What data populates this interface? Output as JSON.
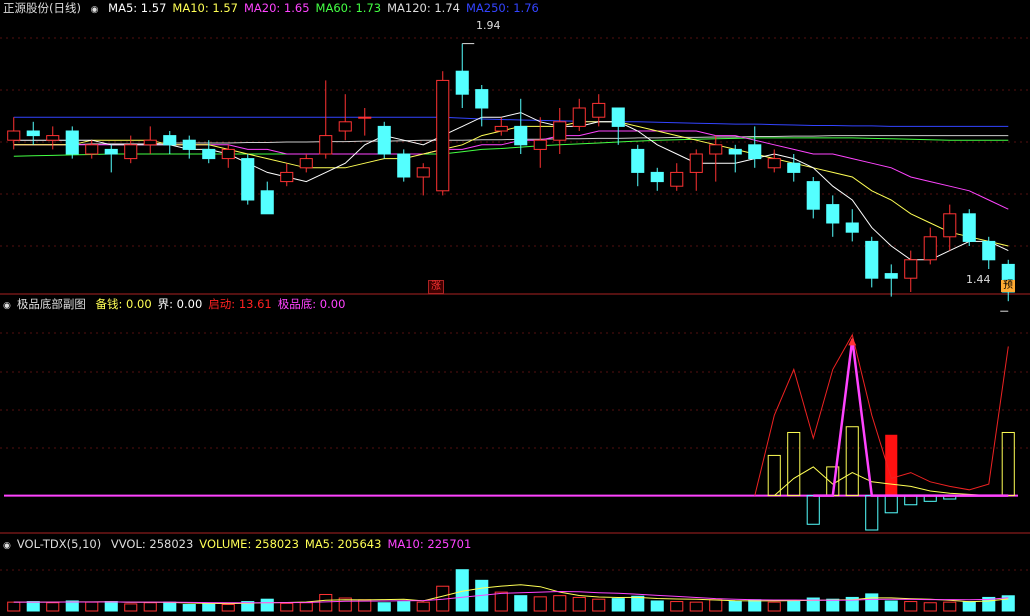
{
  "stock": {
    "name": "正源股份",
    "period": "(日线)"
  },
  "panels": {
    "price": {
      "indicators": [
        {
          "label": "MA5",
          "value": "1.57",
          "color": "#ffffff"
        },
        {
          "label": "MA10",
          "value": "1.57",
          "color": "#ffff55"
        },
        {
          "label": "MA20",
          "value": "1.65",
          "color": "#ff44ff"
        },
        {
          "label": "MA60",
          "value": "1.73",
          "color": "#44ff44"
        },
        {
          "label": "MA120",
          "value": "1.74",
          "color": "#dddddd"
        },
        {
          "label": "MA250",
          "value": "1.76",
          "color": "#3344ff"
        }
      ],
      "high_label": "1.94",
      "low_label": "1.44",
      "marker_zhang": "涨",
      "marker_bottom_right": "预"
    },
    "indicator": {
      "name": "极品底部副图",
      "fields": [
        {
          "label": "备钱",
          "value": "0.00",
          "color": "#ffff55"
        },
        {
          "label": "界",
          "value": "0.00",
          "color": "#ffffff"
        },
        {
          "label": "启动",
          "value": "13.61",
          "color": "#ff2222"
        },
        {
          "label": "极品底",
          "value": "0.00",
          "color": "#ff44ff"
        }
      ]
    },
    "volume": {
      "name": "VOL-TDX(5,10)",
      "fields": [
        {
          "label": "VVOL",
          "value": "258023",
          "color": "#dddddd"
        },
        {
          "label": "VOLUME",
          "value": "258023",
          "color": "#ffff55"
        },
        {
          "label": "MA5",
          "value": "205643",
          "color": "#ffff55"
        },
        {
          "label": "MA10",
          "value": "225701",
          "color": "#ff44ff"
        }
      ]
    }
  },
  "chart_data": [
    {
      "type": "candlestick",
      "ylim": [
        1.4,
        2.0
      ],
      "candles": [
        [
          1.73,
          1.75,
          1.78,
          1.71
        ],
        [
          1.75,
          1.74,
          1.77,
          1.72
        ],
        [
          1.73,
          1.74,
          1.76,
          1.71
        ],
        [
          1.75,
          1.7,
          1.76,
          1.69
        ],
        [
          1.7,
          1.72,
          1.73,
          1.69
        ],
        [
          1.71,
          1.7,
          1.72,
          1.66
        ],
        [
          1.69,
          1.72,
          1.74,
          1.68
        ],
        [
          1.72,
          1.73,
          1.76,
          1.7
        ],
        [
          1.74,
          1.72,
          1.75,
          1.7
        ],
        [
          1.73,
          1.71,
          1.74,
          1.69
        ],
        [
          1.71,
          1.69,
          1.73,
          1.68
        ],
        [
          1.69,
          1.71,
          1.72,
          1.67
        ],
        [
          1.69,
          1.6,
          1.7,
          1.59
        ],
        [
          1.62,
          1.57,
          1.64,
          1.57
        ],
        [
          1.64,
          1.66,
          1.68,
          1.63
        ],
        [
          1.67,
          1.69,
          1.7,
          1.66
        ],
        [
          1.7,
          1.74,
          1.86,
          1.69
        ],
        [
          1.75,
          1.77,
          1.83,
          1.73
        ],
        [
          1.78,
          1.78,
          1.8,
          1.74
        ],
        [
          1.76,
          1.7,
          1.77,
          1.69
        ],
        [
          1.7,
          1.65,
          1.71,
          1.64
        ],
        [
          1.65,
          1.67,
          1.68,
          1.61
        ],
        [
          1.62,
          1.86,
          1.88,
          1.61
        ],
        [
          1.88,
          1.83,
          1.94,
          1.8
        ],
        [
          1.84,
          1.8,
          1.85,
          1.76
        ],
        [
          1.75,
          1.76,
          1.78,
          1.74
        ],
        [
          1.76,
          1.72,
          1.82,
          1.7
        ],
        [
          1.71,
          1.73,
          1.78,
          1.67
        ],
        [
          1.73,
          1.77,
          1.8,
          1.7
        ],
        [
          1.76,
          1.8,
          1.82,
          1.75
        ],
        [
          1.78,
          1.81,
          1.83,
          1.76
        ],
        [
          1.8,
          1.76,
          1.8,
          1.72
        ],
        [
          1.71,
          1.66,
          1.72,
          1.63
        ],
        [
          1.66,
          1.64,
          1.67,
          1.62
        ],
        [
          1.63,
          1.66,
          1.68,
          1.62
        ],
        [
          1.66,
          1.7,
          1.71,
          1.62
        ],
        [
          1.7,
          1.72,
          1.74,
          1.64
        ],
        [
          1.71,
          1.7,
          1.72,
          1.66
        ],
        [
          1.72,
          1.69,
          1.76,
          1.67
        ],
        [
          1.67,
          1.69,
          1.71,
          1.66
        ],
        [
          1.68,
          1.66,
          1.7,
          1.64
        ],
        [
          1.64,
          1.58,
          1.65,
          1.56
        ],
        [
          1.59,
          1.55,
          1.61,
          1.52
        ],
        [
          1.55,
          1.53,
          1.58,
          1.51
        ],
        [
          1.51,
          1.43,
          1.52,
          1.41
        ],
        [
          1.44,
          1.43,
          1.46,
          1.39
        ],
        [
          1.43,
          1.47,
          1.49,
          1.4
        ],
        [
          1.47,
          1.52,
          1.54,
          1.46
        ],
        [
          1.52,
          1.57,
          1.59,
          1.49
        ],
        [
          1.57,
          1.51,
          1.58,
          1.5
        ],
        [
          1.51,
          1.47,
          1.52,
          1.45
        ],
        [
          1.46,
          1.4,
          1.47,
          1.38
        ]
      ],
      "ma5": [
        1.73,
        1.73,
        1.73,
        1.73,
        1.73,
        1.72,
        1.72,
        1.72,
        1.72,
        1.71,
        1.71,
        1.7,
        1.68,
        1.66,
        1.65,
        1.64,
        1.66,
        1.68,
        1.72,
        1.74,
        1.73,
        1.72,
        1.74,
        1.76,
        1.78,
        1.78,
        1.79,
        1.77,
        1.76,
        1.76,
        1.77,
        1.77,
        1.75,
        1.72,
        1.7,
        1.68,
        1.68,
        1.68,
        1.69,
        1.7,
        1.69,
        1.67,
        1.63,
        1.6,
        1.54,
        1.5,
        1.47,
        1.47,
        1.49,
        1.51,
        1.51,
        1.49
      ],
      "ma10": [
        1.72,
        1.72,
        1.72,
        1.72,
        1.73,
        1.73,
        1.73,
        1.73,
        1.72,
        1.72,
        1.72,
        1.71,
        1.7,
        1.69,
        1.68,
        1.67,
        1.67,
        1.67,
        1.68,
        1.69,
        1.69,
        1.7,
        1.71,
        1.72,
        1.74,
        1.75,
        1.76,
        1.76,
        1.76,
        1.77,
        1.77,
        1.77,
        1.76,
        1.75,
        1.74,
        1.73,
        1.72,
        1.71,
        1.7,
        1.69,
        1.68,
        1.67,
        1.66,
        1.65,
        1.62,
        1.6,
        1.57,
        1.55,
        1.53,
        1.52,
        1.51,
        1.5
      ],
      "ma20": [
        1.72,
        1.72,
        1.72,
        1.72,
        1.72,
        1.72,
        1.72,
        1.72,
        1.72,
        1.72,
        1.72,
        1.72,
        1.71,
        1.71,
        1.7,
        1.7,
        1.7,
        1.7,
        1.7,
        1.7,
        1.7,
        1.7,
        1.71,
        1.71,
        1.72,
        1.72,
        1.73,
        1.73,
        1.74,
        1.74,
        1.75,
        1.75,
        1.75,
        1.75,
        1.75,
        1.75,
        1.74,
        1.74,
        1.73,
        1.72,
        1.71,
        1.7,
        1.7,
        1.69,
        1.68,
        1.67,
        1.65,
        1.64,
        1.63,
        1.62,
        1.6,
        1.58
      ],
      "ma60": [
        1.695,
        1.696,
        1.697,
        1.698,
        1.699,
        1.7,
        1.7,
        1.7,
        1.7,
        1.7,
        1.7,
        1.7,
        1.7,
        1.7,
        1.7,
        1.7,
        1.7,
        1.7,
        1.7,
        1.7,
        1.7,
        1.7,
        1.7,
        1.705,
        1.71,
        1.712,
        1.715,
        1.718,
        1.72,
        1.722,
        1.724,
        1.726,
        1.728,
        1.73,
        1.731,
        1.732,
        1.733,
        1.734,
        1.735,
        1.735,
        1.735,
        1.735,
        1.735,
        1.735,
        1.734,
        1.733,
        1.732,
        1.731,
        1.73,
        1.73,
        1.73,
        1.73
      ],
      "ma120": [
        1.72,
        1.72,
        1.72,
        1.72,
        1.722,
        1.722,
        1.722,
        1.722,
        1.724,
        1.724,
        1.724,
        1.724,
        1.725,
        1.725,
        1.726,
        1.726,
        1.727,
        1.727,
        1.728,
        1.728,
        1.729,
        1.73,
        1.73,
        1.73,
        1.731,
        1.731,
        1.732,
        1.732,
        1.733,
        1.733,
        1.734,
        1.734,
        1.735,
        1.735,
        1.736,
        1.736,
        1.737,
        1.737,
        1.738,
        1.738,
        1.739,
        1.739,
        1.74,
        1.74,
        1.74,
        1.74,
        1.74,
        1.74,
        1.74,
        1.74,
        1.74,
        1.74
      ],
      "ma250": [
        1.78,
        1.78,
        1.78,
        1.78,
        1.78,
        1.78,
        1.78,
        1.78,
        1.78,
        1.78,
        1.78,
        1.78,
        1.78,
        1.78,
        1.78,
        1.78,
        1.78,
        1.78,
        1.78,
        1.78,
        1.78,
        1.78,
        1.78,
        1.778,
        1.776,
        1.775,
        1.774,
        1.773,
        1.772,
        1.771,
        1.77,
        1.77,
        1.77,
        1.769,
        1.768,
        1.767,
        1.766,
        1.765,
        1.765,
        1.764,
        1.763,
        1.762,
        1.762,
        1.761,
        1.761,
        1.76,
        1.76,
        1.76,
        1.76,
        1.76,
        1.76,
        1.76
      ]
    },
    {
      "type": "bar",
      "ylim": [
        -3,
        16
      ],
      "yellow_bars": [
        0,
        0,
        0,
        0,
        0,
        0,
        0,
        0,
        0,
        0,
        0,
        0,
        0,
        0,
        0,
        0,
        0,
        0,
        0,
        0,
        0,
        0,
        0,
        0,
        0,
        0,
        0,
        0,
        0,
        0,
        0,
        0,
        0,
        0,
        0,
        0,
        0,
        0,
        0,
        3.5,
        5.5,
        0,
        2.5,
        6,
        0,
        0,
        0,
        0,
        0,
        0,
        0,
        5.5
      ],
      "red_bars": [
        0,
        0,
        0,
        0,
        0,
        0,
        0,
        0,
        0,
        0,
        0,
        0,
        0,
        0,
        0,
        0,
        0,
        0,
        0,
        0,
        0,
        0,
        0,
        0,
        0,
        0,
        0,
        0,
        0,
        0,
        0,
        0,
        0,
        0,
        0,
        0,
        0,
        0,
        0,
        0,
        0,
        0,
        0,
        0,
        0,
        5.3,
        0,
        0,
        0,
        0,
        0,
        0
      ],
      "cyan_bars": [
        0,
        0,
        0,
        0,
        0,
        0,
        0,
        0,
        0,
        0,
        0,
        0,
        0,
        0,
        0,
        0,
        0,
        0,
        0,
        0,
        0,
        0,
        0,
        0,
        0,
        0,
        0,
        0,
        0,
        0,
        0,
        0,
        0,
        0,
        0,
        0,
        0,
        0,
        0,
        0,
        0,
        -2.5,
        0,
        0,
        -3,
        -1.5,
        -0.8,
        -0.5,
        -0.3,
        0,
        0,
        0
      ],
      "red_line": [
        0,
        0,
        0,
        0,
        0,
        0,
        0,
        0,
        0,
        0,
        0,
        0,
        0,
        0,
        0,
        0,
        0,
        0,
        0,
        0,
        0,
        0,
        0,
        0,
        0,
        0,
        0,
        0,
        0,
        0,
        0,
        0,
        0,
        0,
        0,
        0,
        0,
        0,
        0,
        7,
        11,
        5,
        11,
        14,
        7,
        1.5,
        2,
        1.2,
        0.8,
        0.5,
        1,
        13
      ],
      "yellow_line": [
        0,
        0,
        0,
        0,
        0,
        0,
        0,
        0,
        0,
        0,
        0,
        0,
        0,
        0,
        0,
        0,
        0,
        0,
        0,
        0,
        0,
        0,
        0,
        0,
        0,
        0,
        0,
        0,
        0,
        0,
        0,
        0,
        0,
        0,
        0,
        0,
        0,
        0,
        0,
        0,
        1.5,
        2.5,
        1,
        2,
        1.2,
        1,
        0.8,
        0.4,
        0.2,
        0.1,
        0,
        0
      ],
      "magenta_line": [
        0,
        0,
        0,
        0,
        0,
        0,
        0,
        0,
        0,
        0,
        0,
        0,
        0,
        0,
        0,
        0,
        0,
        0,
        0,
        0,
        0,
        0,
        0,
        0,
        0,
        0,
        0,
        0,
        0,
        0,
        0,
        0,
        0,
        0,
        0,
        0,
        0,
        0,
        0,
        0,
        0,
        0,
        0,
        13.61,
        0,
        0,
        0,
        0,
        0,
        0,
        0,
        0
      ]
    },
    {
      "type": "bar",
      "ylim": [
        0,
        1000000
      ],
      "volumes": [
        150000,
        160000,
        140000,
        170000,
        150000,
        160000,
        120000,
        140000,
        150000,
        110000,
        120000,
        110000,
        160000,
        200000,
        130000,
        140000,
        280000,
        220000,
        190000,
        140000,
        160000,
        150000,
        420000,
        700000,
        520000,
        320000,
        260000,
        240000,
        260000,
        230000,
        200000,
        210000,
        250000,
        170000,
        160000,
        150000,
        190000,
        170000,
        190000,
        150000,
        170000,
        220000,
        200000,
        230000,
        290000,
        170000,
        160000,
        140000,
        150000,
        160000,
        230000,
        258023
      ],
      "vol_ma5": [
        150000,
        150000,
        150000,
        154000,
        154000,
        156000,
        148000,
        148000,
        146000,
        136000,
        128000,
        126000,
        132000,
        140000,
        144000,
        152000,
        182000,
        190000,
        188000,
        194000,
        198000,
        172000,
        252000,
        334000,
        388000,
        422000,
        444000,
        412000,
        320000,
        262000,
        238000,
        228000,
        230000,
        212000,
        204000,
        198000,
        186000,
        174000,
        172000,
        172000,
        176000,
        180000,
        186000,
        192000,
        222000,
        222000,
        208000,
        198000,
        182000,
        156000,
        170000,
        205643
      ],
      "vol_ma10": [
        150000,
        150000,
        150000,
        152000,
        152000,
        154000,
        150000,
        150000,
        150000,
        146000,
        142000,
        140000,
        140000,
        140000,
        142000,
        144000,
        155000,
        165000,
        167000,
        170000,
        175000,
        177000,
        198000,
        233000,
        265000,
        298000,
        310000,
        320000,
        330000,
        325000,
        310000,
        300000,
        285000,
        265000,
        248000,
        228000,
        210000,
        200000,
        190000,
        186000,
        186000,
        185000,
        183000,
        184000,
        196000,
        198000,
        196000,
        194000,
        194000,
        192000,
        196000,
        225701
      ]
    }
  ]
}
